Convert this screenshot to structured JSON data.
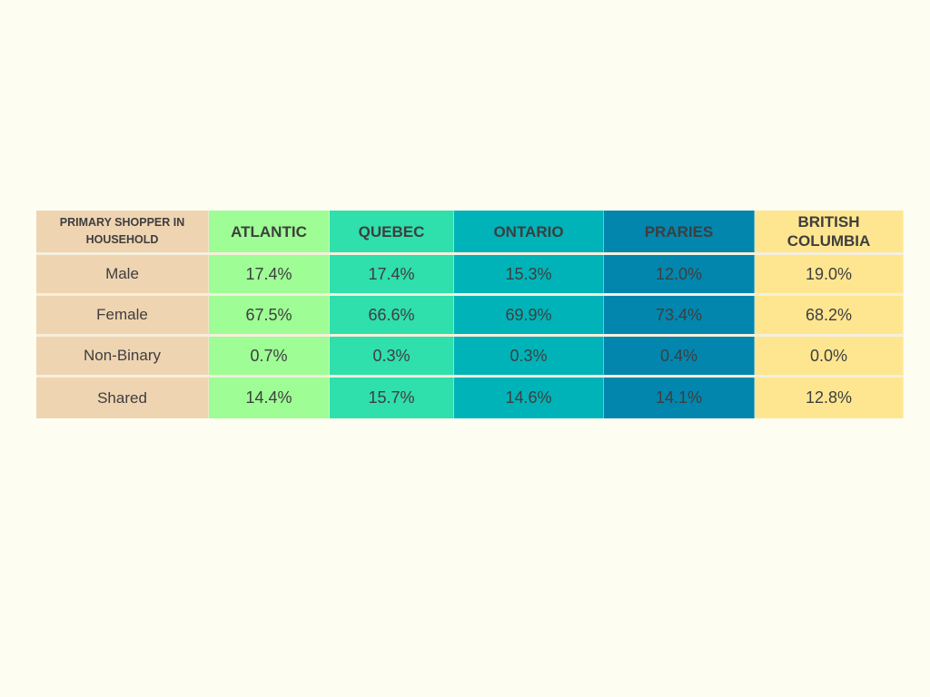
{
  "chart_data": {
    "type": "table",
    "title": "",
    "columns": [
      "PRIMARY SHOPPER IN HOUSEHOLD",
      "ATLANTIC",
      "QUEBEC",
      "ONTARIO",
      "PRARIES",
      "BRITISH COLUMBIA"
    ],
    "column_colors": [
      "#efd4b2",
      "#9efd95",
      "#2fdfac",
      "#00b3b8",
      "#0286ae",
      "#fee691"
    ],
    "rows": [
      {
        "label": "Male",
        "values": [
          "17.4%",
          "17.4%",
          "15.3%",
          "12.0%",
          "19.0%"
        ]
      },
      {
        "label": "Female",
        "values": [
          "67.5%",
          "66.6%",
          "69.9%",
          "73.4%",
          "68.2%"
        ]
      },
      {
        "label": "Non-Binary",
        "values": [
          "0.7%",
          "0.3%",
          "0.3%",
          "0.4%",
          "0.0%"
        ]
      },
      {
        "label": "Shared",
        "values": [
          "14.4%",
          "15.7%",
          "14.6%",
          "14.1%",
          "12.8%"
        ]
      }
    ]
  }
}
